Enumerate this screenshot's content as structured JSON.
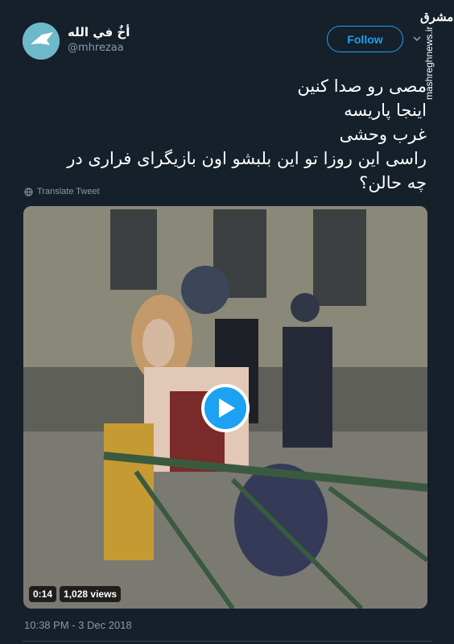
{
  "user": {
    "display_name": "أخٌ في الله",
    "handle": "@mhrezaa",
    "avatar_icon": "bird-on-teal-avatar"
  },
  "follow_button": {
    "label": "Follow"
  },
  "menu_icon": "chevron-down-icon",
  "watermark": {
    "logo_text": "مشرق",
    "site": "mashreghnews.ir"
  },
  "tweet": {
    "lines": [
      "مصی رو صدا کنین",
      "اینجا پاریسه",
      "غرب وحشی",
      "راسی این روزا تو این بلبشو اون بازیگرای فراری در",
      "چه حالن؟"
    ]
  },
  "translate": {
    "label": "Translate Tweet",
    "icon": "globe-icon"
  },
  "video": {
    "duration": "0:14",
    "views": "1,028 views",
    "play_icon": "play-icon"
  },
  "timestamp": "10:38 PM - 3 Dec 2018",
  "colors": {
    "background": "#15202b",
    "accent": "#1da1f2",
    "muted_text": "#8899a6"
  }
}
